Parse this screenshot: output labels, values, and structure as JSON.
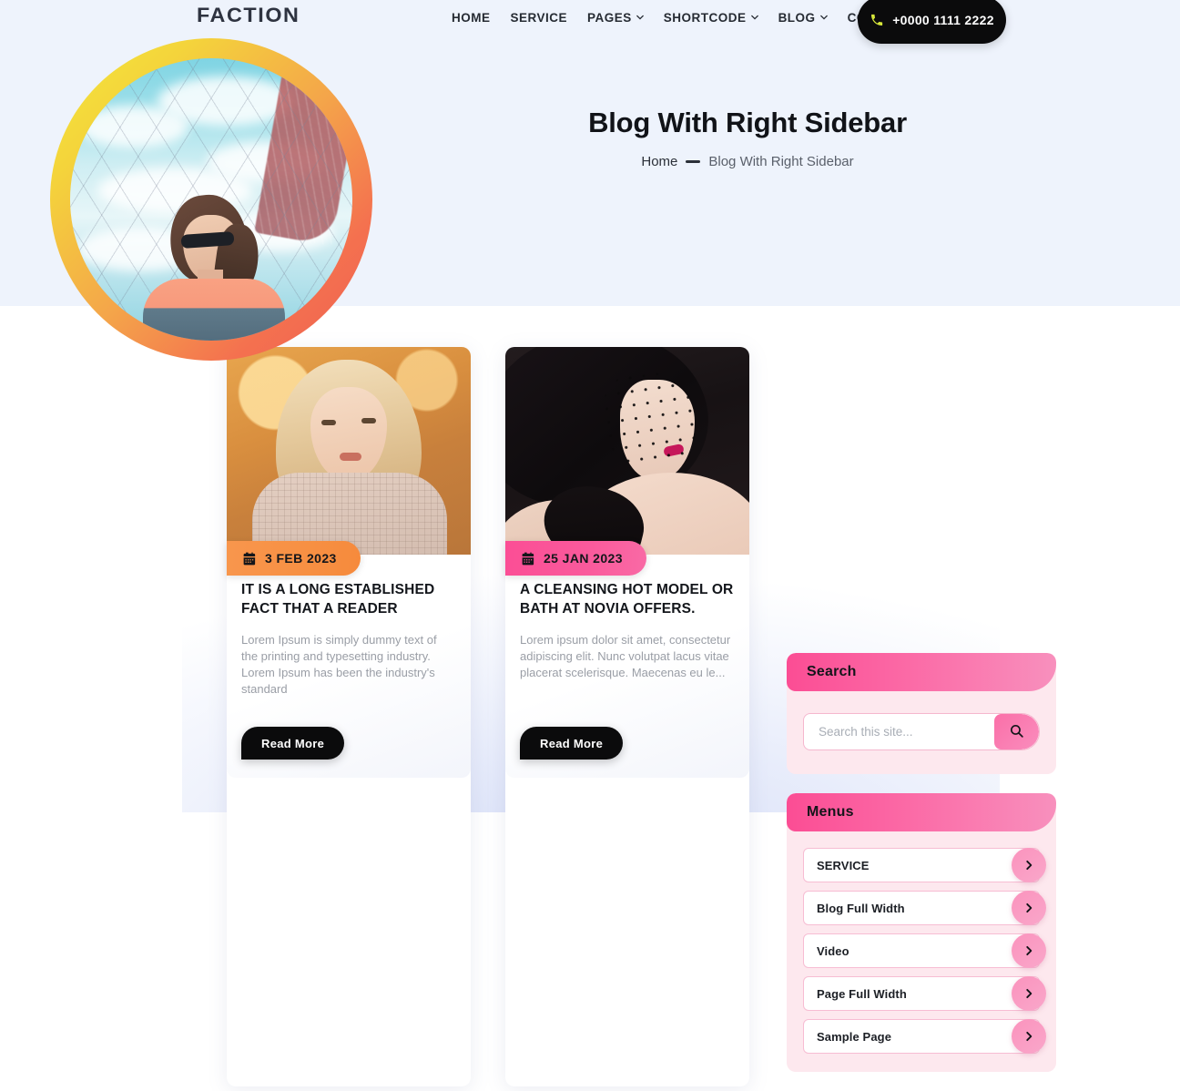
{
  "brand": {
    "logo_text": "FACTION"
  },
  "nav": {
    "items": [
      {
        "label": "HOME",
        "has_dropdown": false
      },
      {
        "label": "SERVICE",
        "has_dropdown": false
      },
      {
        "label": "PAGES",
        "has_dropdown": true
      },
      {
        "label": "SHORTCODE",
        "has_dropdown": true
      },
      {
        "label": "BLOG",
        "has_dropdown": true
      },
      {
        "label": "CONTACT",
        "has_dropdown": false
      }
    ],
    "phone": "+0000 1111 2222"
  },
  "hero": {
    "title": "Blog With Right Sidebar",
    "breadcrumb_home": "Home",
    "breadcrumb_current": "Blog With Right Sidebar"
  },
  "posts": [
    {
      "date": "3 FEB 2023",
      "date_color": "#F79043",
      "title": "It Is A Long Established Fact That A Reader",
      "excerpt": "Lorem Ipsum is simply dummy text of the printing and typesetting industry. Lorem Ipsum has been the industry's standard",
      "button": "Read More"
    },
    {
      "date": "25 JAN 2023",
      "date_color": "#FA5A9C",
      "title": "A Cleansing Hot Model Or Bath At Novia Offers.",
      "excerpt": "Lorem ipsum dolor sit amet, consectetur adipiscing elit. Nunc volutpat lacus vitae placerat scelerisque. Maecenas eu le...",
      "button": "Read More"
    }
  ],
  "sidebar": {
    "search": {
      "title": "Search",
      "placeholder": "Search this site...",
      "value": ""
    },
    "menus": {
      "title": "Menus",
      "items": [
        {
          "label": "SERVICE"
        },
        {
          "label": "Blog Full Width"
        },
        {
          "label": "Video"
        },
        {
          "label": "Page Full Width"
        },
        {
          "label": "Sample Page"
        }
      ]
    }
  },
  "theme": {
    "accent_pink": "#FB4D94",
    "accent_orange": "#F79043",
    "hero_bg": "#EEF3FC",
    "dark": "#0B0B0C"
  }
}
